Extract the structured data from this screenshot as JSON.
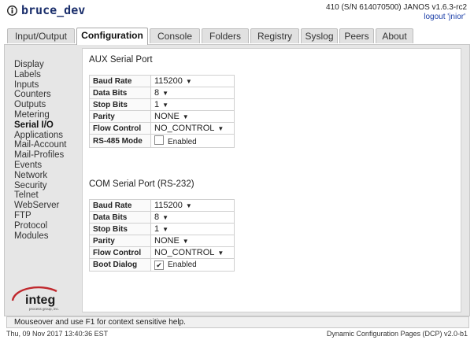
{
  "header": {
    "host": "bruce_dev",
    "sysinfo": "410 (S/N 614070500) JANOS v1.6.3-rc2",
    "logout": "logout 'jnior'"
  },
  "tabs": [
    {
      "label": "Input/Output"
    },
    {
      "label": "Configuration",
      "active": true
    },
    {
      "label": "Console"
    },
    {
      "label": "Folders"
    },
    {
      "label": "Registry"
    },
    {
      "label": "Syslog"
    },
    {
      "label": "Peers"
    },
    {
      "label": "About"
    }
  ],
  "nav": [
    "Display",
    "Labels",
    "Inputs",
    "Counters",
    "Outputs",
    "Metering",
    "Serial I/O",
    "Applications",
    "Mail-Account",
    "Mail-Profiles",
    "Events",
    "Network",
    "Security",
    "Telnet",
    "WebServer",
    "FTP",
    "Protocol",
    "Modules"
  ],
  "nav_active": "Serial I/O",
  "aux": {
    "title": "AUX Serial Port",
    "rows": [
      {
        "label": "Baud Rate",
        "value": "115200"
      },
      {
        "label": "Data Bits",
        "value": "8"
      },
      {
        "label": "Stop Bits",
        "value": "1"
      },
      {
        "label": "Parity",
        "value": "NONE"
      },
      {
        "label": "Flow Control",
        "value": "NO_CONTROL"
      },
      {
        "label": "RS-485 Mode",
        "checkbox_label": "Enabled",
        "checked": false
      }
    ]
  },
  "com": {
    "title": "COM Serial Port (RS-232)",
    "rows": [
      {
        "label": "Baud Rate",
        "value": "115200"
      },
      {
        "label": "Data Bits",
        "value": "8"
      },
      {
        "label": "Stop Bits",
        "value": "1"
      },
      {
        "label": "Parity",
        "value": "NONE"
      },
      {
        "label": "Flow Control",
        "value": "NO_CONTROL"
      },
      {
        "label": "Boot Dialog",
        "checkbox_label": "Enabled",
        "checked": true
      }
    ]
  },
  "logo_text": "integ",
  "logo_sub": "process group, inc.",
  "help_text": "Mouseover and use F1 for context sensitive help.",
  "footer": {
    "date": "Thu, 09 Nov 2017 13:40:36 EST",
    "version": "Dynamic Configuration Pages (DCP) v2.0-b1"
  },
  "colors": {
    "host": "#1a2e6b",
    "link": "#1c3fa8",
    "logo_red": "#c0282d"
  }
}
